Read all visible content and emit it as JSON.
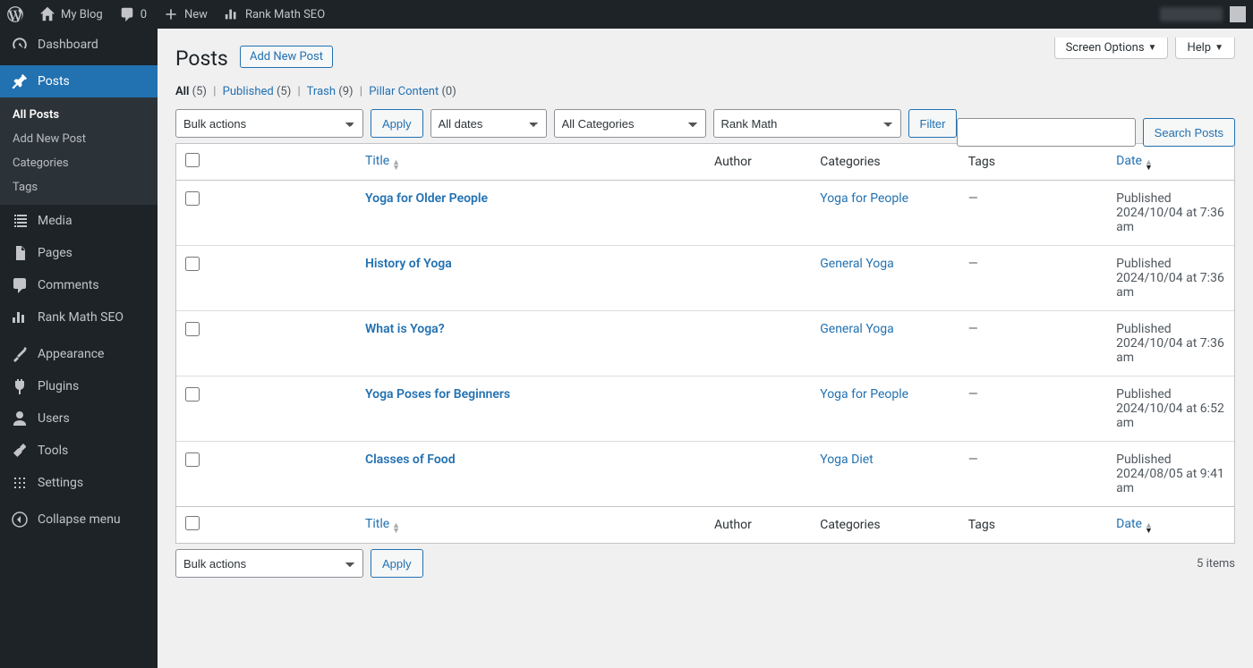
{
  "adminbar": {
    "site_name": "My Blog",
    "comments_count": "0",
    "new_label": "New",
    "rankmath_label": "Rank Math SEO"
  },
  "sidebar": {
    "items": [
      {
        "label": "Dashboard",
        "icon": "dashboard-icon"
      },
      {
        "label": "Posts",
        "icon": "pin-icon",
        "current": true
      },
      {
        "label": "Media",
        "icon": "media-icon"
      },
      {
        "label": "Pages",
        "icon": "pages-icon"
      },
      {
        "label": "Comments",
        "icon": "comments-icon"
      },
      {
        "label": "Rank Math SEO",
        "icon": "rankmath-icon"
      },
      {
        "label": "Appearance",
        "icon": "appearance-icon"
      },
      {
        "label": "Plugins",
        "icon": "plugins-icon"
      },
      {
        "label": "Users",
        "icon": "users-icon"
      },
      {
        "label": "Tools",
        "icon": "tools-icon"
      },
      {
        "label": "Settings",
        "icon": "settings-icon"
      },
      {
        "label": "Collapse menu",
        "icon": "collapse-icon"
      }
    ],
    "submenu": {
      "items": [
        {
          "label": "All Posts",
          "current": true
        },
        {
          "label": "Add New Post"
        },
        {
          "label": "Categories"
        },
        {
          "label": "Tags"
        }
      ]
    }
  },
  "screen_meta": {
    "screen_options": "Screen Options",
    "help": "Help"
  },
  "page": {
    "title": "Posts",
    "add_new": "Add New Post"
  },
  "filters": {
    "all": {
      "label": "All",
      "count": "(5)"
    },
    "published": {
      "label": "Published",
      "count": "(5)"
    },
    "trash": {
      "label": "Trash",
      "count": "(9)"
    },
    "pillar": {
      "label": "Pillar Content",
      "count": "(0)"
    }
  },
  "search": {
    "button": "Search Posts"
  },
  "bulk": {
    "bulk_actions": "Bulk actions",
    "apply": "Apply",
    "all_dates": "All dates",
    "all_categories": "All Categories",
    "rankmath": "Rank Math",
    "filter": "Filter",
    "items_count": "5 items"
  },
  "columns": {
    "title": "Title",
    "author": "Author",
    "categories": "Categories",
    "tags": "Tags",
    "date": "Date"
  },
  "posts": [
    {
      "title": "Yoga for Older People",
      "category": "Yoga for People",
      "tags": "—",
      "status": "Published",
      "date": "2024/10/04 at 7:36 am"
    },
    {
      "title": "History of Yoga",
      "category": "General Yoga",
      "tags": "—",
      "status": "Published",
      "date": "2024/10/04 at 7:36 am"
    },
    {
      "title": "What is Yoga?",
      "category": "General Yoga",
      "tags": "—",
      "status": "Published",
      "date": "2024/10/04 at 7:36 am"
    },
    {
      "title": "Yoga Poses for Beginners",
      "category": "Yoga for People",
      "tags": "—",
      "status": "Published",
      "date": "2024/10/04 at 6:52 am"
    },
    {
      "title": "Classes of Food",
      "category": "Yoga Diet",
      "tags": "—",
      "status": "Published",
      "date": "2024/08/05 at 9:41 am"
    }
  ]
}
